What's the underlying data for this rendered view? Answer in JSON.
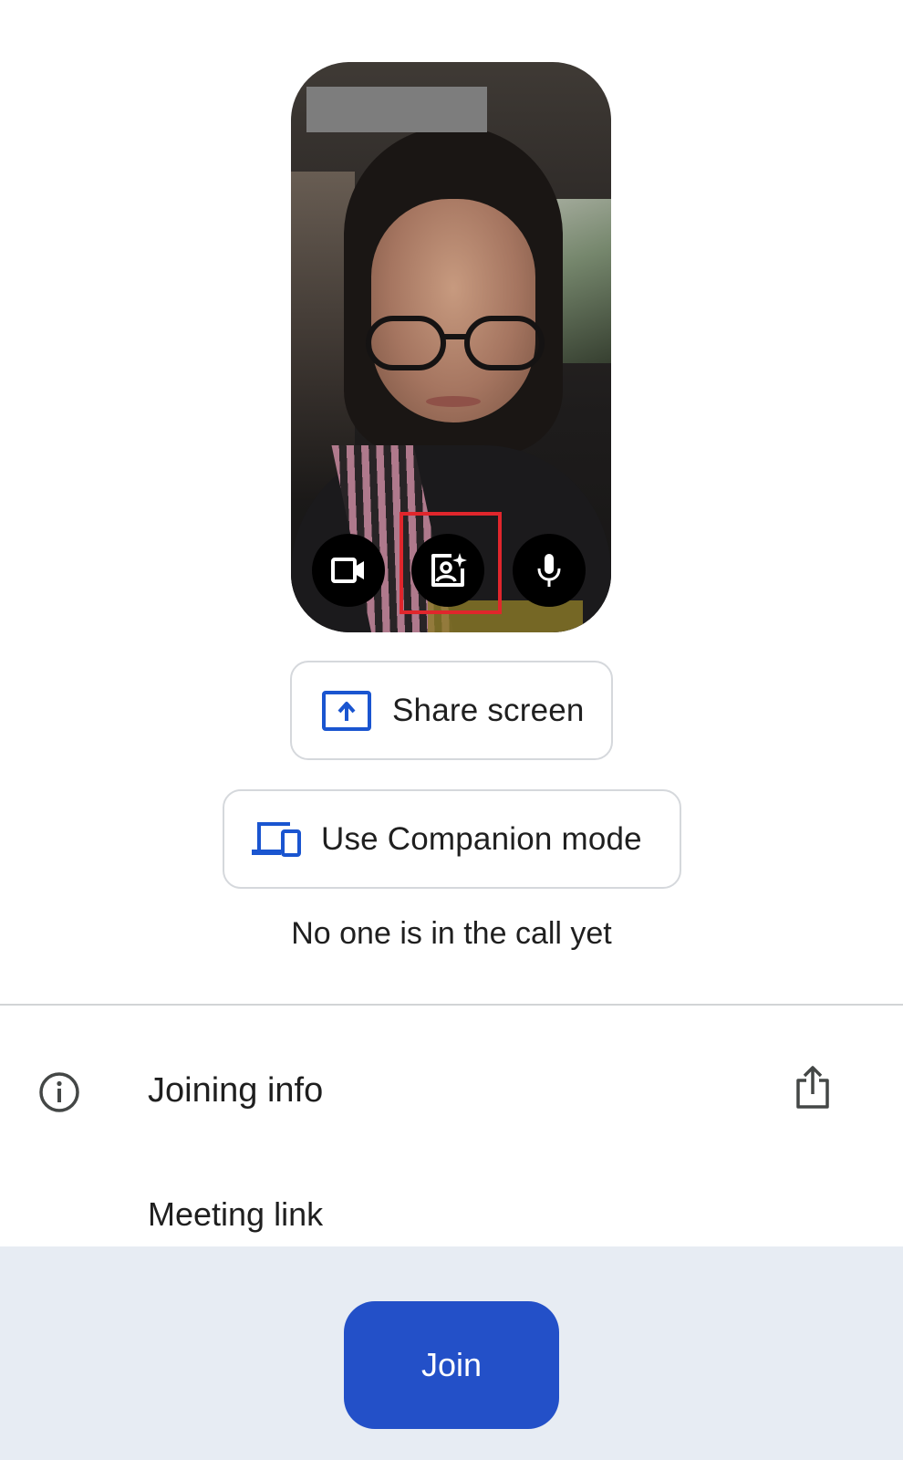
{
  "preview": {
    "controls": [
      {
        "icon": "videocam-icon"
      },
      {
        "icon": "visual-effects-icon"
      },
      {
        "icon": "microphone-icon"
      }
    ],
    "highlight_color": "#e0262c"
  },
  "actions": {
    "share_screen_label": "Share screen",
    "companion_mode_label": "Use Companion mode"
  },
  "status": {
    "text": "No one is in the call yet"
  },
  "joining_info": {
    "title": "Joining info",
    "meeting_link_label": "Meeting link"
  },
  "join": {
    "label": "Join",
    "color": "#2350c8"
  },
  "colors": {
    "accent": "#2350c8",
    "bottom_bar": "#e7ecf3",
    "icon_blue": "#1a55d0"
  }
}
